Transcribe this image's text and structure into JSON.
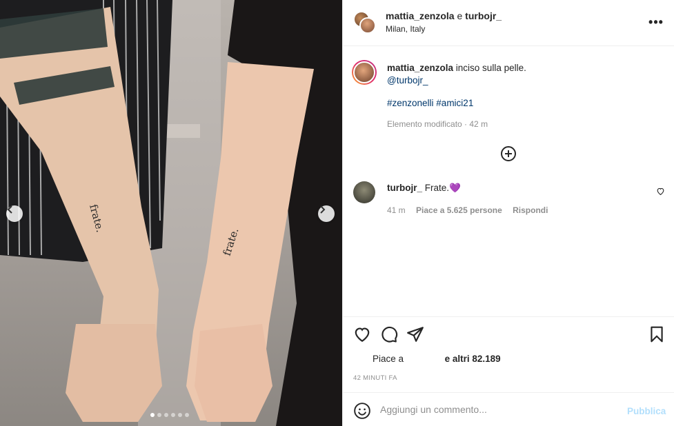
{
  "post": {
    "header": {
      "user1": "mattia_zenzola",
      "conj": "e",
      "user2": "turbojr_",
      "location": "Milan, Italy"
    },
    "caption": {
      "user": "mattia_zenzola",
      "text": "inciso sulla pelle.",
      "mention": "@turbojr_",
      "hashtags": "#zenzonelli #amici21",
      "edited": "Elemento modificato · 42 m"
    },
    "comment": {
      "user": "turbojr_",
      "text": "Frate.",
      "emoji": "💜",
      "time": "41 m",
      "likes": "Piace a 5.625 persone",
      "reply": "Rispondi"
    },
    "likes": {
      "prefix": "Piace a",
      "others": "e altri 82.189"
    },
    "time_ago": "42 MINUTI FA",
    "add_comment": {
      "placeholder": "Aggiungi un commento...",
      "publish": "Pubblica"
    }
  },
  "photo": {
    "tattoo_left": "frate.",
    "tattoo_right": "frate.",
    "carousel_count": 6,
    "carousel_active": 1
  },
  "colors": {
    "link": "#00376b",
    "muted": "#8e8e8e",
    "publish_disabled": "#b2dffc"
  }
}
